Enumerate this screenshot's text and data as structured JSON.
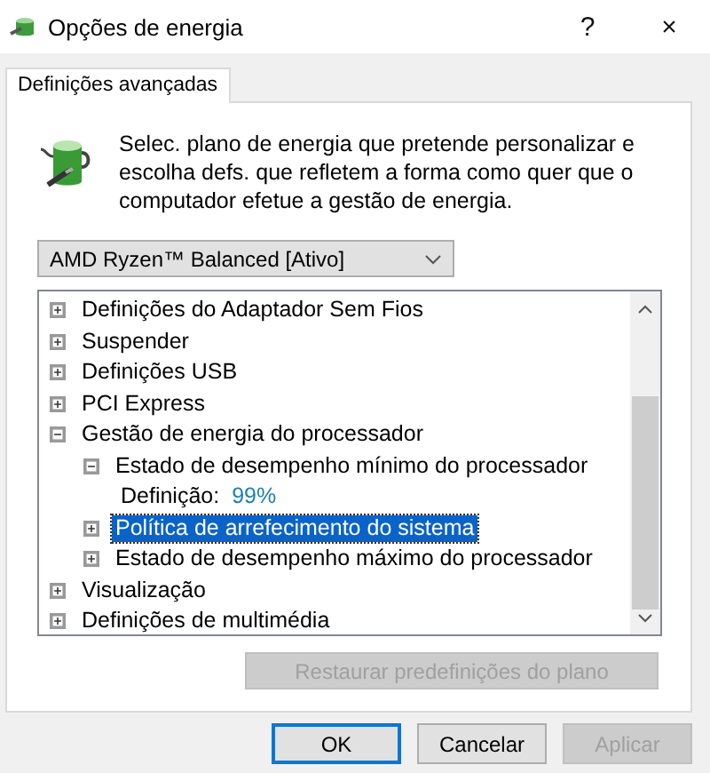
{
  "window": {
    "title": "Opções de energia",
    "help": "?",
    "close": "×"
  },
  "tabs": [
    {
      "label": "Definições avançadas",
      "selected": true
    }
  ],
  "description": "Selec. plano de energia que pretende personalizar e escolha defs. que refletem a forma como quer que o computador efetue a gestão de energia.",
  "plan_dropdown": {
    "value": "AMD Ryzen™ Balanced [Ativo]"
  },
  "tree": [
    {
      "kind": "group",
      "label": "Definições do Adaptador Sem Fios",
      "expanded": false,
      "selected": false
    },
    {
      "kind": "group",
      "label": "Suspender",
      "expanded": false,
      "selected": false
    },
    {
      "kind": "group",
      "label": "Definições USB",
      "expanded": false,
      "selected": false
    },
    {
      "kind": "group",
      "label": "PCI Express",
      "expanded": false,
      "selected": false
    },
    {
      "kind": "group",
      "label": "Gestão de energia do processador",
      "expanded": true,
      "selected": false,
      "children": [
        {
          "kind": "group",
          "label": "Estado de desempenho mínimo do processador",
          "expanded": true,
          "selected": false,
          "children": [
            {
              "kind": "setting",
              "label": "Definição:",
              "value": "99%",
              "selected": false
            }
          ]
        },
        {
          "kind": "group",
          "label": "Política de arrefecimento do sistema",
          "expanded": false,
          "selected": true
        },
        {
          "kind": "group",
          "label": "Estado de desempenho máximo do processador",
          "expanded": false,
          "selected": false
        }
      ]
    },
    {
      "kind": "group",
      "label": "Visualização",
      "expanded": false,
      "selected": false
    },
    {
      "kind": "group",
      "label": "Definições de multimédia",
      "expanded": false,
      "selected": false
    }
  ],
  "restore_button": {
    "label": "Restaurar predefinições do plano",
    "disabled": true
  },
  "buttons": [
    {
      "label": "OK",
      "default": true,
      "disabled": false
    },
    {
      "label": "Cancelar",
      "default": false,
      "disabled": false
    },
    {
      "label": "Aplicar",
      "default": false,
      "disabled": true
    }
  ]
}
